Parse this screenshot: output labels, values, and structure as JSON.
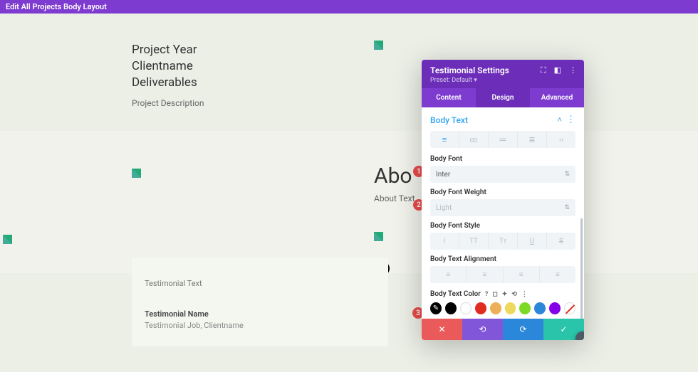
{
  "topbar": {
    "title": "Edit All Projects Body Layout"
  },
  "upper": {
    "project_year": "Project Year",
    "clientname": "Clientname",
    "deliverables": "Deliverables",
    "description": "Project Description"
  },
  "about": {
    "title": "Abo",
    "text": "About Text"
  },
  "testimonial": {
    "text": "Testimonial Text",
    "name": "Testimonial Name",
    "job": "Testimonial Job, Clientname"
  },
  "badges": {
    "b1": "1",
    "b2": "2",
    "b3": "3"
  },
  "panel": {
    "title": "Testimonial Settings",
    "preset": "Preset: Default",
    "tabs": {
      "content": "Content",
      "design": "Design",
      "advanced": "Advanced"
    },
    "section": "Body Text",
    "labels": {
      "body_font": "Body Font",
      "body_font_weight": "Body Font Weight",
      "body_font_style": "Body Font Style",
      "body_text_alignment": "Body Text Alignment",
      "body_text_color": "Body Text Color"
    },
    "values": {
      "font": "Inter",
      "weight": "Light"
    }
  }
}
